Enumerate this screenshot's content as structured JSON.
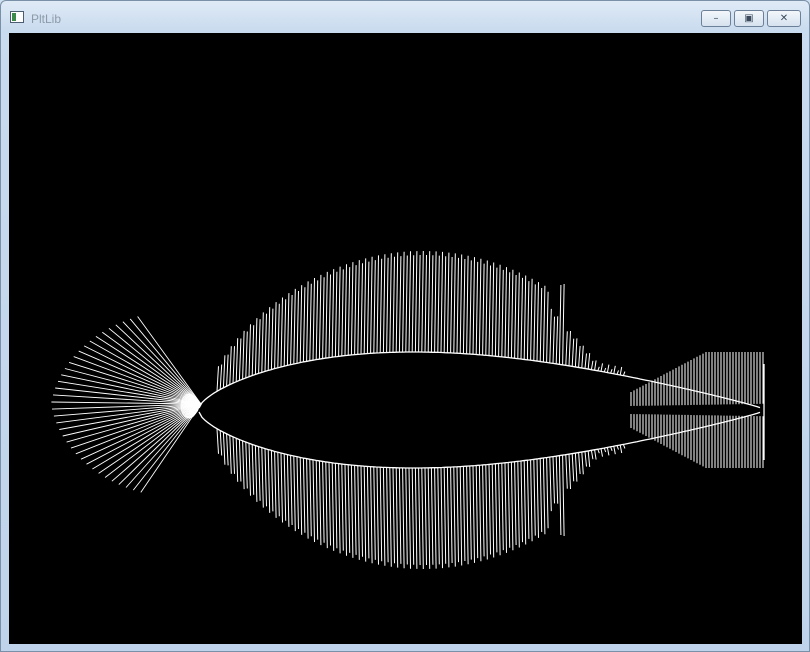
{
  "window": {
    "title": "PltLib",
    "controls": {
      "minimize": "–",
      "maximize": "▣",
      "close": "✕"
    }
  },
  "canvas": {
    "background": "#000000",
    "stroke": "#ffffff"
  },
  "icons": {
    "app": "app-icon",
    "minimize": "minimize-icon",
    "maximize": "maximize-icon",
    "close": "close-icon"
  }
}
